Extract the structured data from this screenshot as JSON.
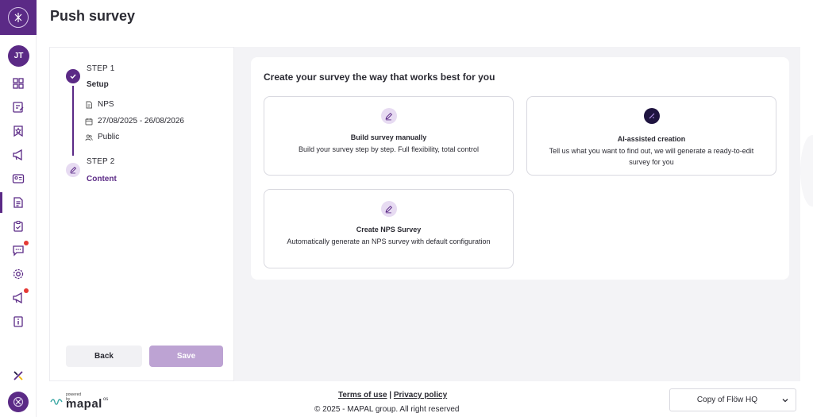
{
  "header": {
    "title": "Push survey"
  },
  "user": {
    "initials": "JT"
  },
  "colors": {
    "brand": "#5b2a86",
    "brand_light": "#e7dbf2",
    "save_disabled": "#bda3d3",
    "badge": "#e53935"
  },
  "sidebar": {
    "items": [
      {
        "icon": "grid-icon"
      },
      {
        "icon": "edit-note-icon"
      },
      {
        "icon": "star-badge-icon"
      },
      {
        "icon": "megaphone-icon"
      },
      {
        "icon": "id-card-icon"
      },
      {
        "icon": "survey-doc-icon",
        "active": true
      },
      {
        "icon": "clipboard-check-icon"
      },
      {
        "icon": "chat-icon",
        "badge": true
      },
      {
        "icon": "settings-icon"
      },
      {
        "icon": "megaphone-icon",
        "badge": true
      },
      {
        "icon": "info-book-icon"
      }
    ]
  },
  "steps": {
    "step1": {
      "label": "STEP 1",
      "name": "Setup",
      "details": [
        {
          "icon": "document-icon",
          "text": "NPS"
        },
        {
          "icon": "calendar-icon",
          "text": "27/08/2025 - 26/08/2026"
        },
        {
          "icon": "people-icon",
          "text": "Public"
        }
      ]
    },
    "step2": {
      "label": "STEP 2",
      "name": "Content"
    },
    "back_label": "Back",
    "save_label": "Save"
  },
  "main": {
    "heading": "Create your survey the way that works best for you",
    "options": [
      {
        "title": "Build survey manually",
        "description": "Build your survey step by step. Full flexibility, total control",
        "icon": "pencil-icon"
      },
      {
        "title": "AI-assisted creation",
        "description": "Tell us what you want to find out, we will generate a ready-to-edit survey for you",
        "icon": "ai-sparkle-icon"
      },
      {
        "title": "Create NPS Survey",
        "description": "Automatically generate an NPS survey with default configuration",
        "icon": "pencil-icon"
      }
    ]
  },
  "footer": {
    "powered_by": "powered by",
    "brand": "mapal",
    "brand_suffix": "os",
    "terms": "Terms of use",
    "separator": "|",
    "privacy": "Privacy policy",
    "copyright": "© 2025 - MAPAL group. All right reserved",
    "location": "Copy of Flöw HQ"
  }
}
